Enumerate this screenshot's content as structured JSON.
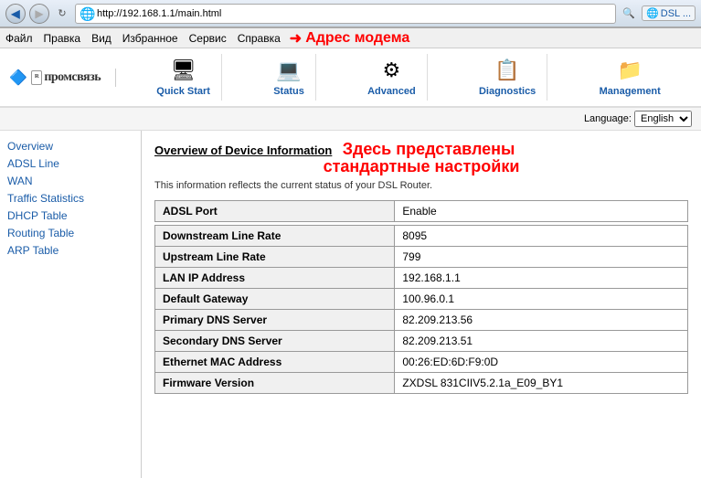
{
  "browser": {
    "address": "http://192.168.1.1/main.html",
    "back_btn": "◀",
    "refresh_icon": "↻",
    "search_placeholder": "DSL ...",
    "ie_icon": "🌐"
  },
  "menu": {
    "items": [
      "Файл",
      "Правка",
      "Вид",
      "Избранное",
      "Сервис",
      "Справка"
    ],
    "annotation": "Адрес модема"
  },
  "logo": {
    "icon": "🔷",
    "text": "промсвязь"
  },
  "nav_tabs": [
    {
      "id": "quick-start",
      "label": "Quick Start",
      "icon": "🖥"
    },
    {
      "id": "status",
      "label": "Status",
      "icon": "💻"
    },
    {
      "id": "advanced",
      "label": "Advanced",
      "icon": "⚙"
    },
    {
      "id": "diagnostics",
      "label": "Diagnostics",
      "icon": "📋"
    },
    {
      "id": "management",
      "label": "Management",
      "icon": "📁"
    }
  ],
  "language": {
    "label": "Language:",
    "selected": "English",
    "options": [
      "English"
    ]
  },
  "sidebar": {
    "items": [
      "Overview",
      "ADSL Line",
      "WAN",
      "Traffic Statistics",
      "DHCP Table",
      "Routing Table",
      "ARP Table"
    ]
  },
  "content": {
    "title": "Overview of Device Information",
    "annotation_line1": "Здесь представлены",
    "annotation_line2": "стандартные настройки",
    "subtitle": "This information reflects the current status of your DSL Router.",
    "table_rows": [
      {
        "label": "ADSL Port",
        "value": "Enable",
        "spacer_before": false
      },
      {
        "label": "Downstream Line Rate",
        "value": "8095",
        "spacer_before": true
      },
      {
        "label": "Upstream Line Rate",
        "value": "799",
        "spacer_before": false
      },
      {
        "label": "LAN IP Address",
        "value": "192.168.1.1",
        "spacer_before": false
      },
      {
        "label": "Default Gateway",
        "value": "100.96.0.1",
        "spacer_before": false
      },
      {
        "label": "Primary DNS Server",
        "value": "82.209.213.56",
        "spacer_before": false
      },
      {
        "label": "Secondary DNS Server",
        "value": "82.209.213.51",
        "spacer_before": false
      },
      {
        "label": "Ethernet MAC Address",
        "value": "00:26:ED:6D:F9:0D",
        "spacer_before": false
      },
      {
        "label": "Firmware Version",
        "value": "ZXDSL 831CIIV5.2.1a_E09_BY1",
        "spacer_before": false
      }
    ]
  }
}
